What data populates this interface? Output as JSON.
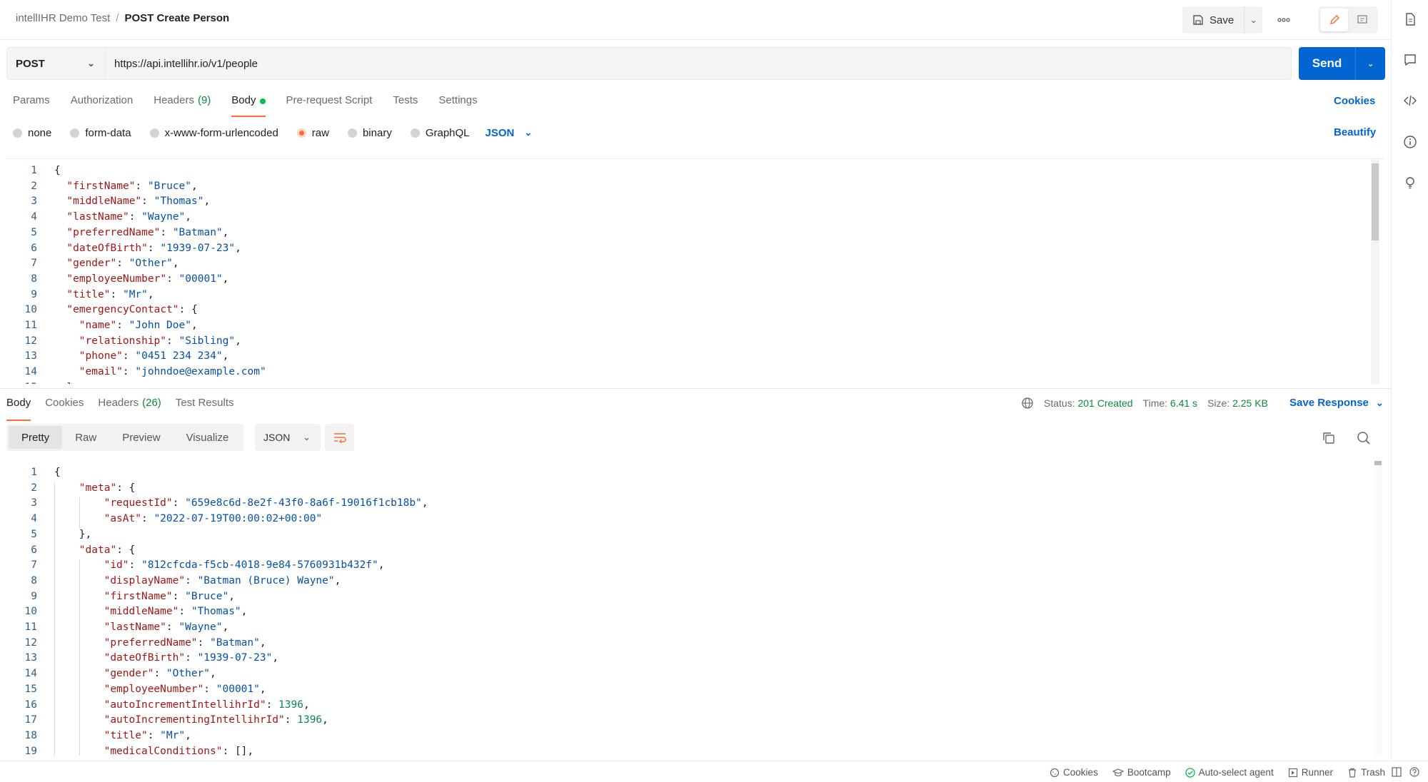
{
  "header": {
    "workspace": "intellIHR Demo Test",
    "separator": "/",
    "request_title": "POST Create Person",
    "save_label": "Save"
  },
  "request": {
    "method": "POST",
    "url": "https://api.intellihr.io/v1/people",
    "send_label": "Send",
    "tabs": [
      {
        "label": "Params"
      },
      {
        "label": "Authorization"
      },
      {
        "label": "Headers",
        "count": "(9)"
      },
      {
        "label": "Body"
      },
      {
        "label": "Pre-request Script"
      },
      {
        "label": "Tests"
      },
      {
        "label": "Settings"
      }
    ],
    "cookies_label": "Cookies",
    "body_types": [
      "none",
      "form-data",
      "x-www-form-urlencoded",
      "raw",
      "binary",
      "GraphQL"
    ],
    "selected_body_type": "raw",
    "language": "JSON",
    "beautify_label": "Beautify",
    "body_lines": [
      "{",
      "\"firstName\": \"Bruce\",",
      "\"middleName\": \"Thomas\",",
      "\"lastName\": \"Wayne\",",
      "\"preferredName\": \"Batman\",",
      "\"dateOfBirth\": \"1939-07-23\",",
      "\"gender\": \"Other\",",
      "\"employeeNumber\": \"00001\",",
      "\"title\": \"Mr\",",
      "\"emergencyContact\": {",
      "\"name\": \"John Doe\",",
      "\"relationship\": \"Sibling\",",
      "\"phone\": \"0451 234 234\",",
      "\"email\": \"johndoe@example.com\"",
      "},"
    ]
  },
  "response": {
    "tabs": [
      {
        "label": "Body"
      },
      {
        "label": "Cookies"
      },
      {
        "label": "Headers",
        "count": "(26)"
      },
      {
        "label": "Test Results"
      }
    ],
    "status_label": "Status:",
    "status_value": "201 Created",
    "time_label": "Time:",
    "time_value": "6.41 s",
    "size_label": "Size:",
    "size_value": "2.25 KB",
    "save_response_label": "Save Response",
    "view_modes": [
      "Pretty",
      "Raw",
      "Preview",
      "Visualize"
    ],
    "format": "JSON",
    "body_lines": [
      "{",
      "\"meta\": {",
      "\"requestId\": \"659e8c6d-8e2f-43f0-8a6f-19016f1cb18b\",",
      "\"asAt\": \"2022-07-19T00:00:02+00:00\"",
      "},",
      "\"data\": {",
      "\"id\": \"812cfcda-f5cb-4018-9e84-5760931b432f\",",
      "\"displayName\": \"Batman (Bruce) Wayne\",",
      "\"firstName\": \"Bruce\",",
      "\"middleName\": \"Thomas\",",
      "\"lastName\": \"Wayne\",",
      "\"preferredName\": \"Batman\",",
      "\"dateOfBirth\": \"1939-07-23\",",
      "\"gender\": \"Other\",",
      "\"employeeNumber\": \"00001\",",
      "\"autoIncrementIntellihrId\": 1396,",
      "\"autoIncrementingIntellihrId\": 1396,",
      "\"title\": \"Mr\",",
      "\"medicalConditions\": [],"
    ]
  },
  "footer": {
    "items": [
      "Cookies",
      "Bootcamp",
      "Auto-select agent",
      "Runner",
      "Trash"
    ]
  },
  "colors": {
    "accent": "#ff6c37",
    "primary_blue": "#0265d2",
    "success_green": "#0cbb52",
    "json_key": "#a31515",
    "json_string": "#0451a5",
    "json_number": "#098658"
  },
  "icons": [
    "save-icon",
    "chevron-down-icon",
    "more-icon",
    "edit-icon",
    "comment-icon",
    "document-icon",
    "code-icon",
    "info-icon",
    "bulb-icon",
    "globe-icon",
    "copy-icon",
    "search-icon",
    "wrap-icon",
    "cookie-icon",
    "bootcamp-icon",
    "agent-check-icon",
    "runner-icon",
    "trash-icon",
    "two-pane-icon",
    "help-icon"
  ]
}
